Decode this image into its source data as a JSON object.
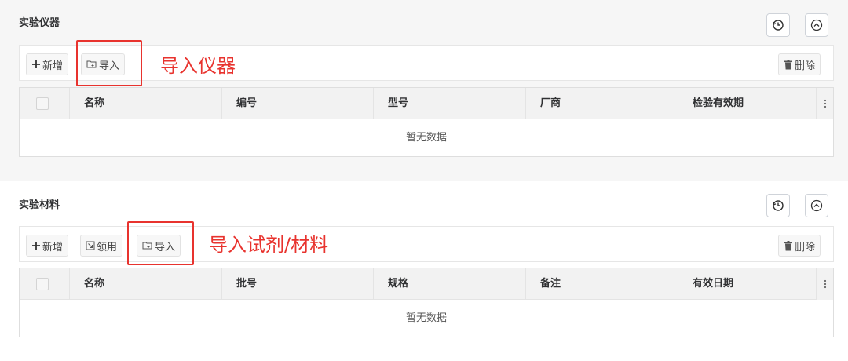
{
  "instruments": {
    "title": "实验仪器",
    "toolbar": {
      "add_label": "新增",
      "import_label": "导入",
      "delete_label": "删除"
    },
    "callout": "导入仪器",
    "columns": [
      "名称",
      "编号",
      "型号",
      "厂商",
      "检验有效期"
    ],
    "empty_text": "暂无数据"
  },
  "materials": {
    "title": "实验材料",
    "toolbar": {
      "add_label": "新增",
      "claim_label": "领用",
      "import_label": "导入",
      "delete_label": "删除"
    },
    "callout": "导入试剂/材料",
    "columns": [
      "名称",
      "批号",
      "规格",
      "备注",
      "有效日期"
    ],
    "empty_text": "暂无数据"
  },
  "icons": {
    "history": "history-icon",
    "collapse": "chevron-up-circle-icon",
    "add": "plus-icon",
    "import": "folder-import-icon",
    "claim": "claim-icon",
    "delete": "trash-icon",
    "more": "vertical-dots-icon"
  },
  "colors": {
    "annotation_red": "#e8332e",
    "section_bg": "#f6f6f6",
    "header_bg": "#f2f2f2"
  }
}
